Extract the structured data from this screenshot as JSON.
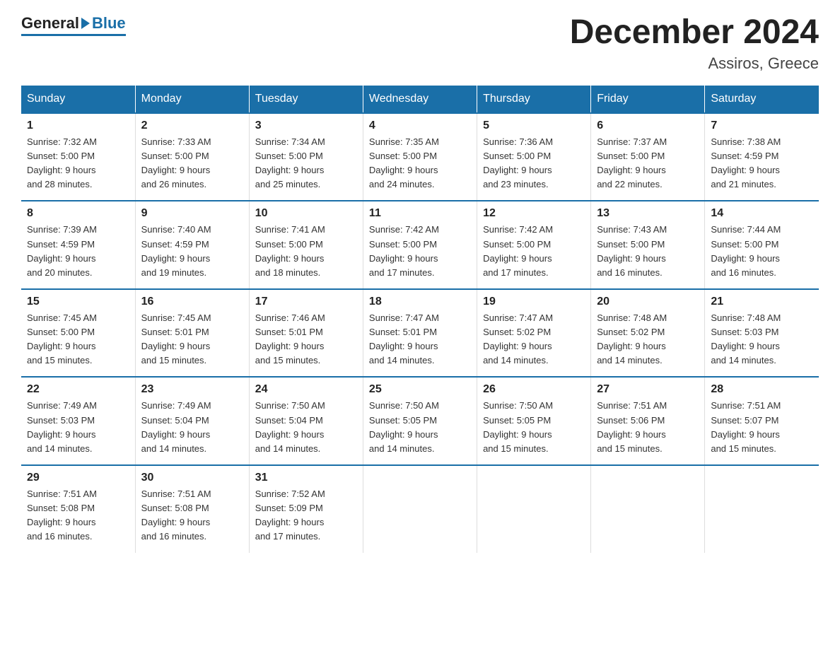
{
  "logo": {
    "general": "General",
    "blue": "Blue"
  },
  "header": {
    "month": "December 2024",
    "location": "Assiros, Greece"
  },
  "weekdays": [
    "Sunday",
    "Monday",
    "Tuesday",
    "Wednesday",
    "Thursday",
    "Friday",
    "Saturday"
  ],
  "weeks": [
    [
      {
        "day": "1",
        "sunrise": "7:32 AM",
        "sunset": "5:00 PM",
        "daylight": "9 hours and 28 minutes."
      },
      {
        "day": "2",
        "sunrise": "7:33 AM",
        "sunset": "5:00 PM",
        "daylight": "9 hours and 26 minutes."
      },
      {
        "day": "3",
        "sunrise": "7:34 AM",
        "sunset": "5:00 PM",
        "daylight": "9 hours and 25 minutes."
      },
      {
        "day": "4",
        "sunrise": "7:35 AM",
        "sunset": "5:00 PM",
        "daylight": "9 hours and 24 minutes."
      },
      {
        "day": "5",
        "sunrise": "7:36 AM",
        "sunset": "5:00 PM",
        "daylight": "9 hours and 23 minutes."
      },
      {
        "day": "6",
        "sunrise": "7:37 AM",
        "sunset": "5:00 PM",
        "daylight": "9 hours and 22 minutes."
      },
      {
        "day": "7",
        "sunrise": "7:38 AM",
        "sunset": "4:59 PM",
        "daylight": "9 hours and 21 minutes."
      }
    ],
    [
      {
        "day": "8",
        "sunrise": "7:39 AM",
        "sunset": "4:59 PM",
        "daylight": "9 hours and 20 minutes."
      },
      {
        "day": "9",
        "sunrise": "7:40 AM",
        "sunset": "4:59 PM",
        "daylight": "9 hours and 19 minutes."
      },
      {
        "day": "10",
        "sunrise": "7:41 AM",
        "sunset": "5:00 PM",
        "daylight": "9 hours and 18 minutes."
      },
      {
        "day": "11",
        "sunrise": "7:42 AM",
        "sunset": "5:00 PM",
        "daylight": "9 hours and 17 minutes."
      },
      {
        "day": "12",
        "sunrise": "7:42 AM",
        "sunset": "5:00 PM",
        "daylight": "9 hours and 17 minutes."
      },
      {
        "day": "13",
        "sunrise": "7:43 AM",
        "sunset": "5:00 PM",
        "daylight": "9 hours and 16 minutes."
      },
      {
        "day": "14",
        "sunrise": "7:44 AM",
        "sunset": "5:00 PM",
        "daylight": "9 hours and 16 minutes."
      }
    ],
    [
      {
        "day": "15",
        "sunrise": "7:45 AM",
        "sunset": "5:00 PM",
        "daylight": "9 hours and 15 minutes."
      },
      {
        "day": "16",
        "sunrise": "7:45 AM",
        "sunset": "5:01 PM",
        "daylight": "9 hours and 15 minutes."
      },
      {
        "day": "17",
        "sunrise": "7:46 AM",
        "sunset": "5:01 PM",
        "daylight": "9 hours and 15 minutes."
      },
      {
        "day": "18",
        "sunrise": "7:47 AM",
        "sunset": "5:01 PM",
        "daylight": "9 hours and 14 minutes."
      },
      {
        "day": "19",
        "sunrise": "7:47 AM",
        "sunset": "5:02 PM",
        "daylight": "9 hours and 14 minutes."
      },
      {
        "day": "20",
        "sunrise": "7:48 AM",
        "sunset": "5:02 PM",
        "daylight": "9 hours and 14 minutes."
      },
      {
        "day": "21",
        "sunrise": "7:48 AM",
        "sunset": "5:03 PM",
        "daylight": "9 hours and 14 minutes."
      }
    ],
    [
      {
        "day": "22",
        "sunrise": "7:49 AM",
        "sunset": "5:03 PM",
        "daylight": "9 hours and 14 minutes."
      },
      {
        "day": "23",
        "sunrise": "7:49 AM",
        "sunset": "5:04 PM",
        "daylight": "9 hours and 14 minutes."
      },
      {
        "day": "24",
        "sunrise": "7:50 AM",
        "sunset": "5:04 PM",
        "daylight": "9 hours and 14 minutes."
      },
      {
        "day": "25",
        "sunrise": "7:50 AM",
        "sunset": "5:05 PM",
        "daylight": "9 hours and 14 minutes."
      },
      {
        "day": "26",
        "sunrise": "7:50 AM",
        "sunset": "5:05 PM",
        "daylight": "9 hours and 15 minutes."
      },
      {
        "day": "27",
        "sunrise": "7:51 AM",
        "sunset": "5:06 PM",
        "daylight": "9 hours and 15 minutes."
      },
      {
        "day": "28",
        "sunrise": "7:51 AM",
        "sunset": "5:07 PM",
        "daylight": "9 hours and 15 minutes."
      }
    ],
    [
      {
        "day": "29",
        "sunrise": "7:51 AM",
        "sunset": "5:08 PM",
        "daylight": "9 hours and 16 minutes."
      },
      {
        "day": "30",
        "sunrise": "7:51 AM",
        "sunset": "5:08 PM",
        "daylight": "9 hours and 16 minutes."
      },
      {
        "day": "31",
        "sunrise": "7:52 AM",
        "sunset": "5:09 PM",
        "daylight": "9 hours and 17 minutes."
      },
      null,
      null,
      null,
      null
    ]
  ]
}
